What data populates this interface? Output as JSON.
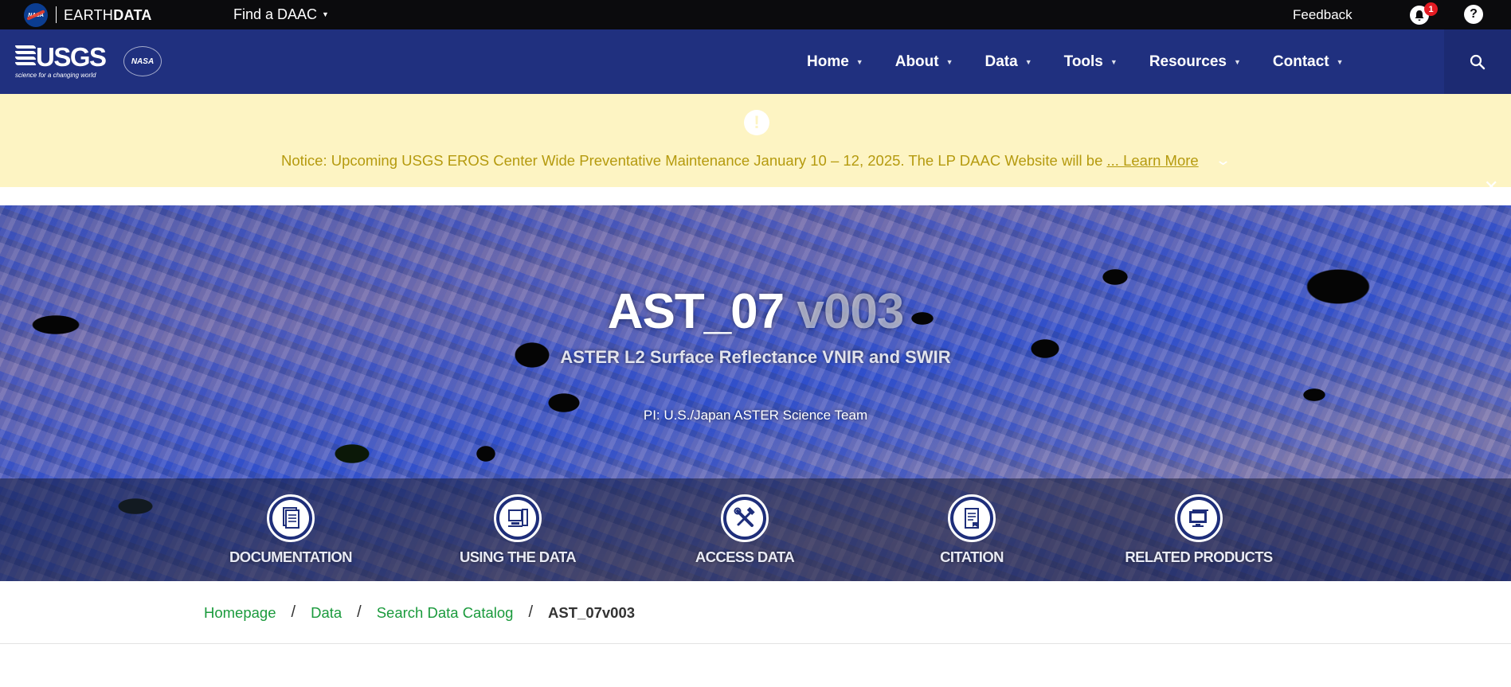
{
  "topbar": {
    "nasa_logo_text": "NASA",
    "brand_prefix": "EARTH",
    "brand_suffix": "DATA",
    "find_daac": "Find a DAAC",
    "feedback": "Feedback",
    "notification_count": "1",
    "help_icon": "?"
  },
  "navbar": {
    "usgs_word": "USGS",
    "usgs_tagline": "science for a changing world",
    "nasa_logo_text": "NASA",
    "items": [
      {
        "label": "Home"
      },
      {
        "label": "About"
      },
      {
        "label": "Data"
      },
      {
        "label": "Tools"
      },
      {
        "label": "Resources"
      },
      {
        "label": "Contact"
      }
    ],
    "search_icon": "search-icon"
  },
  "notice": {
    "text": "Notice: Upcoming USGS EROS Center Wide Preventative Maintenance January 10 – 12, 2025. The LP DAAC Website will be ",
    "link": "... Learn More "
  },
  "hero": {
    "title": "AST_07",
    "version": " v003",
    "subtitle": "ASTER L2 Surface Reflectance VNIR and SWIR",
    "pi": "PI: U.S./Japan ASTER Science Team",
    "links": [
      {
        "label": "DOCUMENTATION",
        "icon": "document-icon"
      },
      {
        "label": "USING THE DATA",
        "icon": "computer-icon"
      },
      {
        "label": "ACCESS DATA",
        "icon": "tools-icon"
      },
      {
        "label": "CITATION",
        "icon": "citation-icon"
      },
      {
        "label": "RELATED PRODUCTS",
        "icon": "monitor-icon"
      }
    ]
  },
  "breadcrumb": {
    "items": [
      "Homepage",
      "Data",
      "Search Data Catalog"
    ],
    "current": "AST_07v003"
  },
  "colors": {
    "topbar_bg": "#0b0b0d",
    "nav_bg": "#20307f",
    "notice_bg": "#fdf4c3",
    "notice_text": "#b59a0e",
    "breadcrumb_link": "#1a9a3c",
    "badge": "#e31b23"
  }
}
